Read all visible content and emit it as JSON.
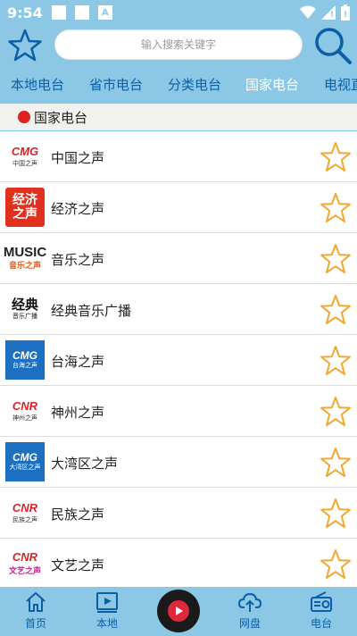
{
  "status": {
    "time": "9:54",
    "a_icon_text": "A"
  },
  "header": {
    "search_placeholder": "输入搜索关键字"
  },
  "tabs": [
    {
      "label": "本地电台",
      "active": false
    },
    {
      "label": "省市电台",
      "active": false
    },
    {
      "label": "分类电台",
      "active": false
    },
    {
      "label": "国家电台",
      "active": true
    },
    {
      "label": "电视直",
      "active": false
    }
  ],
  "section": {
    "title": "国家电台"
  },
  "stations": [
    {
      "name": "中国之声",
      "logo_main": "CMG",
      "logo_sub": "中国之声"
    },
    {
      "name": "经济之声",
      "logo_main": "经济",
      "logo_sub": "之声"
    },
    {
      "name": "音乐之声",
      "logo_main": "MUSIC",
      "logo_sub": "音乐之声"
    },
    {
      "name": "经典音乐广播",
      "logo_main": "经典",
      "logo_sub": "音乐广播"
    },
    {
      "name": "台海之声",
      "logo_main": "CMG",
      "logo_sub": "台海之声"
    },
    {
      "name": "神州之声",
      "logo_main": "CNR",
      "logo_sub": "神州之声"
    },
    {
      "name": "大湾区之声",
      "logo_main": "CMG",
      "logo_sub": "大湾区之声"
    },
    {
      "name": "民族之声",
      "logo_main": "CNR",
      "logo_sub": "民族之声"
    },
    {
      "name": "文艺之声",
      "logo_main": "CNR",
      "logo_sub": "文艺之声"
    }
  ],
  "bottom_nav": [
    {
      "label": "首页",
      "icon": "home-icon"
    },
    {
      "label": "本地",
      "icon": "play-icon"
    },
    {
      "label": "网盘",
      "icon": "cloud-upload-icon"
    },
    {
      "label": "电台",
      "icon": "radio-icon"
    }
  ],
  "colors": {
    "bar": "#8cc8e6",
    "tab_text": "#0a5fa8",
    "star": "#f0a830",
    "accent_red": "#e02020"
  }
}
